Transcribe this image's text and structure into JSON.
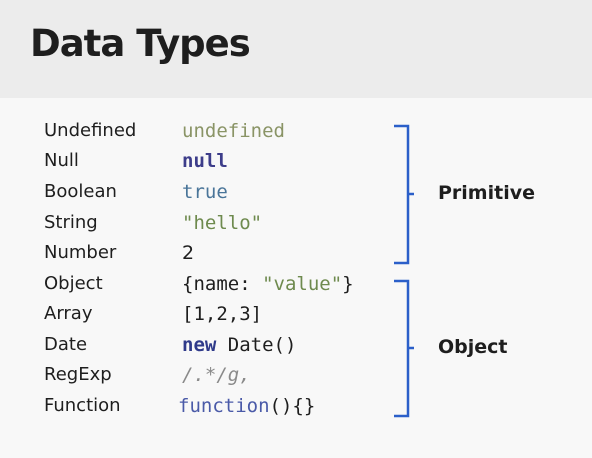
{
  "title": "Data Types",
  "rows": [
    {
      "type": "Undefined",
      "example": [
        "undefined"
      ]
    },
    {
      "type": "Null",
      "example": [
        "null"
      ]
    },
    {
      "type": "Boolean",
      "example": [
        "true"
      ]
    },
    {
      "type": "String",
      "example": [
        "\"hello\""
      ]
    },
    {
      "type": "Number",
      "example": [
        "2"
      ]
    },
    {
      "type": "Object",
      "example": [
        "{name",
        ": ",
        "\"value\"",
        "}"
      ]
    },
    {
      "type": "Array",
      "example": [
        "[1,2,3]"
      ]
    },
    {
      "type": "Date",
      "example": [
        "new",
        " Date()"
      ]
    },
    {
      "type": "RegExp",
      "example": [
        "/.*/g,"
      ]
    },
    {
      "type": "Function",
      "example": [
        "function",
        "(){}"
      ]
    }
  ],
  "groups": {
    "primitive": "Primitive",
    "object": "Object"
  },
  "colors": {
    "bracket": "#2b5fc9"
  }
}
